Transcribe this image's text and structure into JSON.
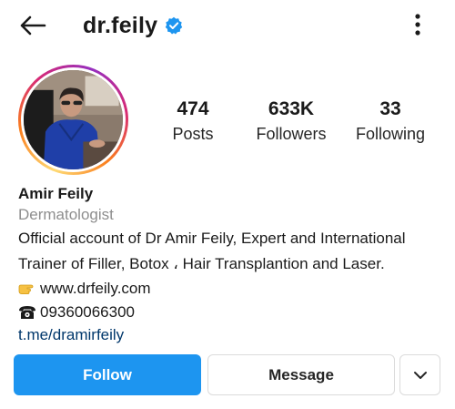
{
  "header": {
    "username": "dr.feily",
    "verified": true,
    "accent_color": "#1d95f0"
  },
  "stats": {
    "posts": {
      "value": "474",
      "label": "Posts"
    },
    "followers": {
      "value": "633K",
      "label": "Followers"
    },
    "following": {
      "value": "33",
      "label": "Following"
    }
  },
  "bio": {
    "name": "Amir Feily",
    "category": "Dermatologist",
    "line1": "Official account of Dr Amir Feily, Expert and International",
    "line2": "Trainer of Filler, Botox ، Hair Transplantion and Laser.",
    "website_emoji": "pointing-hand-icon",
    "website": "www.drfeily.com",
    "phone_emoji": "telephone-icon",
    "phone": "09360066300",
    "link": "t.me/dramirfeily"
  },
  "actions": {
    "follow_label": "Follow",
    "message_label": "Message",
    "more_icon": "chevron-down-icon"
  }
}
